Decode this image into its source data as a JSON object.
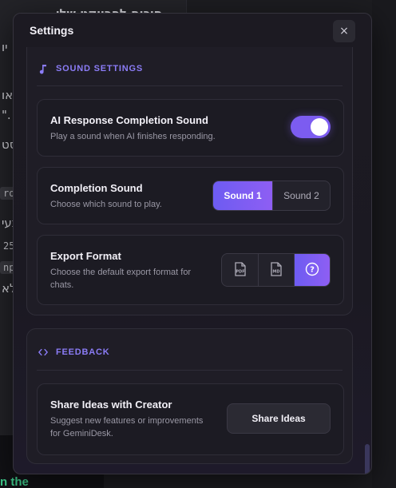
{
  "background": {
    "lines": [
      "סיכום לפרויקט שלי",
      "יו",
      "או",
      "\".",
      "סט",
      "ro",
      "בעי",
      "25",
      "np",
      "לא"
    ],
    "bottom_text": "n the"
  },
  "dialog": {
    "title": "Settings",
    "close_label": "×"
  },
  "sound_section": {
    "label": "SOUND SETTINGS",
    "icon": "music-note-icon",
    "response_sound": {
      "title": "AI Response Completion Sound",
      "description": "Play a sound when AI finishes responding.",
      "enabled": true
    },
    "completion_sound": {
      "title": "Completion Sound",
      "description": "Choose which sound to play.",
      "options": [
        "Sound 1",
        "Sound 2"
      ],
      "selected": "Sound 1"
    },
    "export_format": {
      "title": "Export Format",
      "description_line1": "Choose the default export format for",
      "description_line2": "chats.",
      "options": [
        {
          "icon": "pdf-file-icon",
          "label": "PDF"
        },
        {
          "icon": "md-file-icon",
          "label": "MD"
        },
        {
          "icon": "question-icon",
          "label": "?"
        }
      ],
      "selected_index": 2
    }
  },
  "feedback_section": {
    "label": "FEEDBACK",
    "icon": "code-icon",
    "share": {
      "title": "Share Ideas with Creator",
      "description_line1": "Suggest new features or improvements",
      "description_line2": "for GeminiDesk.",
      "button_label": "Share Ideas"
    }
  },
  "colors": {
    "accent": "#8b7cf6",
    "toggle_on": "#7c5cf0",
    "active_segment_start": "#6d5cf2",
    "active_segment_end": "#8e5ef3"
  }
}
